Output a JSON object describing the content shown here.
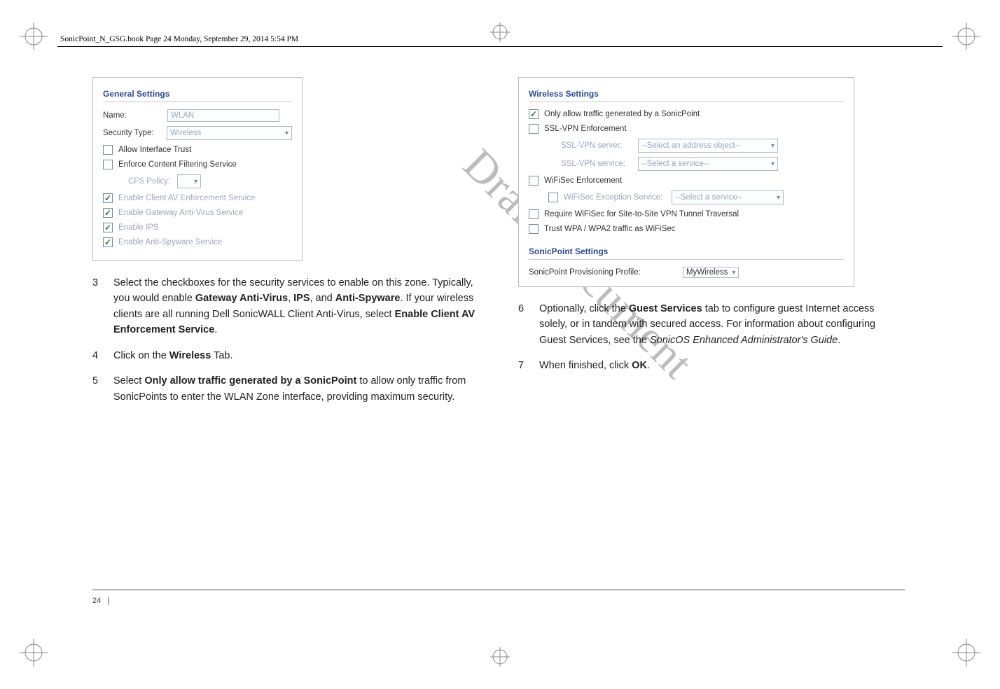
{
  "header": {
    "text": "SonicPoint_N_GSG.book  Page 24  Monday, September 29, 2014  5:54 PM"
  },
  "watermark": "Draft Document",
  "footer": {
    "page": "24",
    "sep": "|"
  },
  "left_panel": {
    "section_title": "General Settings",
    "name_label": "Name:",
    "name_value": "WLAN",
    "sectype_label": "Security Type:",
    "sectype_value": "Wireless",
    "allow_if_trust": "Allow Interface Trust",
    "enforce_cfs": "Enforce Content Filtering Service",
    "cfs_policy_label": "CFS Policy:",
    "enable_av": "Enable Client AV Enforcement Service",
    "enable_gw_av": "Enable Gateway Anti-Virus Service",
    "enable_ips": "Enable IPS",
    "enable_antispy": "Enable Anti-Spyware Service"
  },
  "right_panel": {
    "section_title": "Wireless Settings",
    "only_allow": "Only allow traffic generated by a SonicPoint",
    "ssl_vpn_enf": "SSL-VPN Enforcement",
    "ssl_vpn_server_label": "SSL-VPN server:",
    "ssl_vpn_server_value": "--Select an address object--",
    "ssl_vpn_service_label": "SSL-VPN service:",
    "ssl_vpn_service_value": "--Select a service--",
    "wifisec_enf": "WiFiSec Enforcement",
    "wifisec_exc_label": "WiFiSec Exception Service:",
    "wifisec_exc_value": "--Select a service--",
    "require_wifisec": "Require WiFiSec for Site-to-Site VPN Tunnel Traversal",
    "trust_wpa": "Trust WPA / WPA2 traffic as WiFiSec",
    "sp_section_title": "SonicPoint Settings",
    "prov_label": "SonicPoint Provisioning Profile:",
    "prov_value": "MyWireless"
  },
  "steps_left": {
    "s3_a": "Select the checkboxes for the security services to enable on this zone. Typically, you would enable ",
    "s3_b1": "Gateway Anti-Virus",
    "s3_b2": "IPS",
    "s3_b3": "Anti-Spyware",
    "s3_c": ". If your wireless clients are all running Dell SonicWALL Client Anti-Virus, select ",
    "s3_d": "Enable Client AV Enforcement Service",
    "s4_a": "Click on the ",
    "s4_b": "Wireless",
    "s4_c": " Tab.",
    "s5_a": "Select ",
    "s5_b": "Only allow traffic generated by a SonicPoint",
    "s5_c": " to allow only traffic from SonicPoints to enter the WLAN Zone interface, providing maximum security."
  },
  "steps_right": {
    "s6_a": "Optionally, click the ",
    "s6_b": "Guest Services",
    "s6_c": " tab to configure guest Internet access solely, or in tandem with secured access. For information about configuring Guest Services, see the ",
    "s6_d": "SonicOS Enhanced Administrator's Guide",
    "s7_a": "When finished, click ",
    "s7_b": "OK"
  },
  "nums": {
    "n3": "3",
    "n4": "4",
    "n5": "5",
    "n6": "6",
    "n7": "7"
  },
  "misc": {
    "comma_and": ", and ",
    "comma_sp": ", ",
    "period": "."
  }
}
